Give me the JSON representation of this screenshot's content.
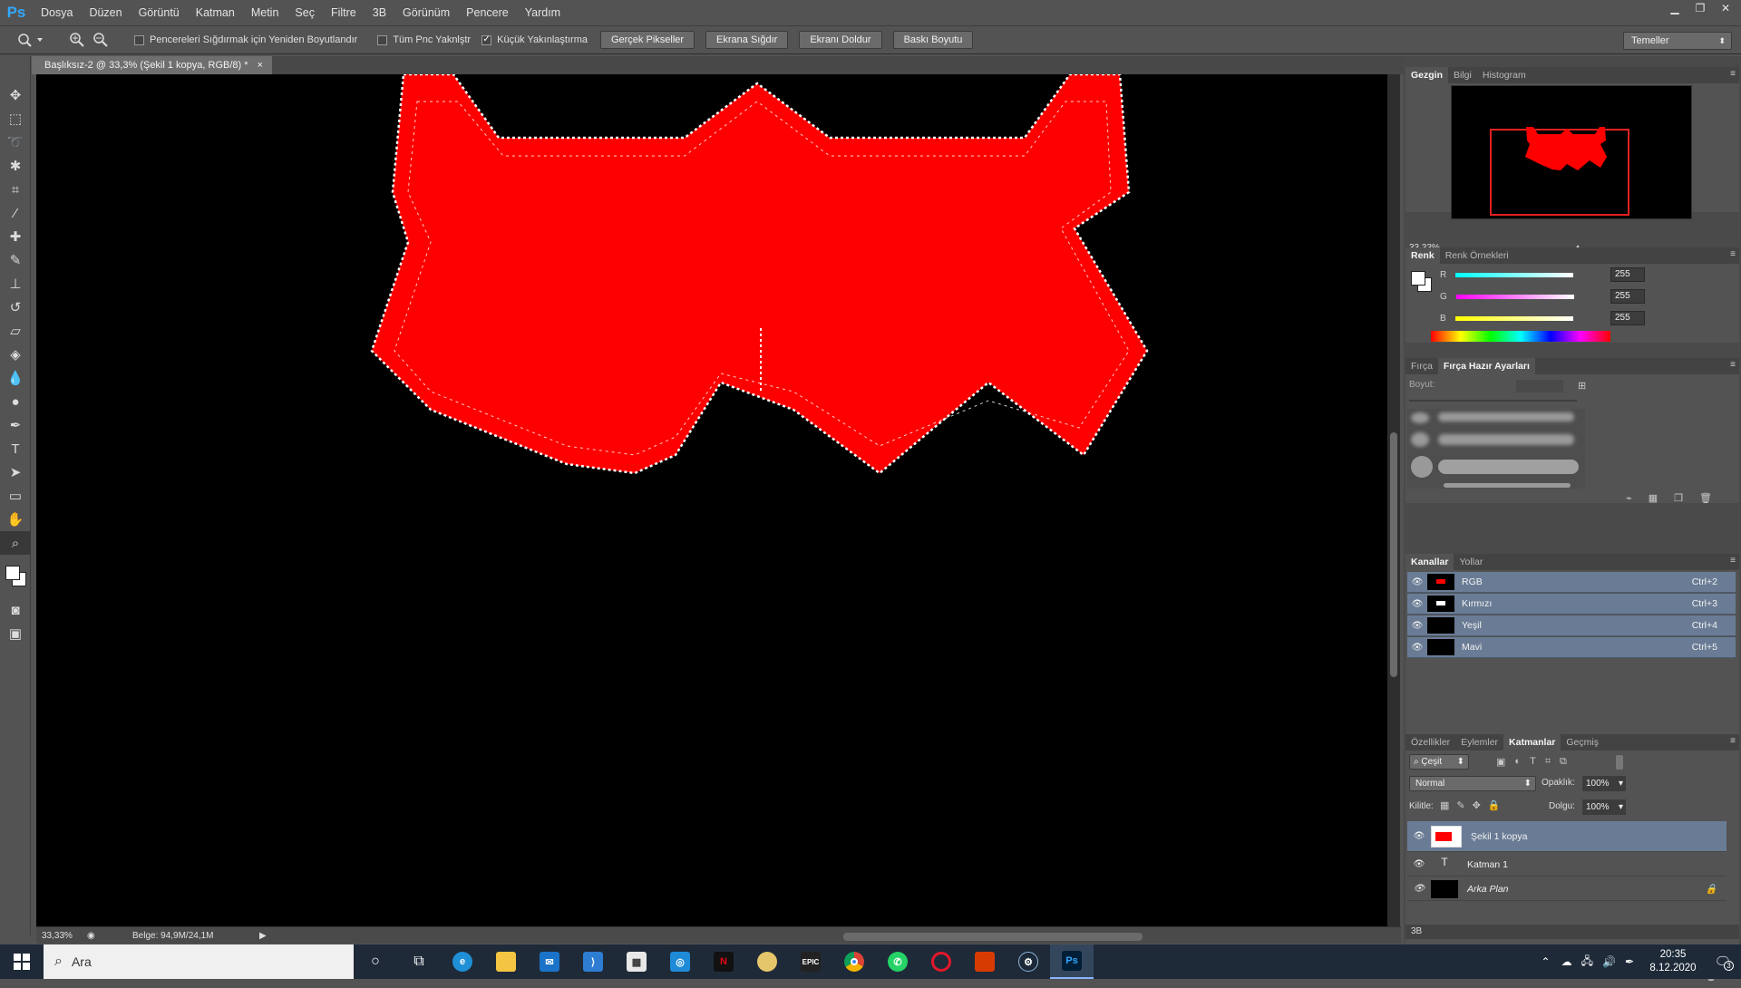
{
  "app": {
    "logo": "Ps"
  },
  "menu": [
    "Dosya",
    "Düzen",
    "Görüntü",
    "Katman",
    "Metin",
    "Seç",
    "Filtre",
    "3B",
    "Görünüm",
    "Pencere",
    "Yardım"
  ],
  "options": {
    "checkboxes": [
      {
        "label": "Pencereleri Sığdırmak için Yeniden Boyutlandır",
        "checked": false
      },
      {
        "label": "Tüm Pnc Yaknlştr",
        "checked": false
      },
      {
        "label": "Küçük Yakınlaştırma",
        "checked": true
      }
    ],
    "buttons": [
      "Gerçek Pikseller",
      "Ekrana Sığdır",
      "Ekranı Doldur",
      "Baskı Boyutu"
    ],
    "workspace": "Temeller"
  },
  "document": {
    "tab_title": "Başlıksız-2 @ 33,3% (Şekil 1 kopya, RGB/8) *",
    "close": "×",
    "fill_color": "#ff0000",
    "background_color": "#000000"
  },
  "status": {
    "zoom": "33,33%",
    "doc_info": "Belge: 94,9M/24,1M"
  },
  "navigator": {
    "tabs": [
      "Gezgin",
      "Bilgi",
      "Histogram"
    ],
    "zoom": "33,33%"
  },
  "color": {
    "tabs": [
      "Renk",
      "Renk Örnekleri"
    ],
    "channels": [
      {
        "label": "R",
        "value": "255"
      },
      {
        "label": "G",
        "value": "255"
      },
      {
        "label": "B",
        "value": "255"
      }
    ]
  },
  "brush": {
    "tabs": [
      "Fırça",
      "Fırça Hazır Ayarları"
    ],
    "size_label": "Boyut:"
  },
  "channels": {
    "tabs": [
      "Kanallar",
      "Yollar"
    ],
    "rows": [
      {
        "name": "RGB",
        "key": "Ctrl+2"
      },
      {
        "name": "Kırmızı",
        "key": "Ctrl+3"
      },
      {
        "name": "Yeşil",
        "key": "Ctrl+4"
      },
      {
        "name": "Mavi",
        "key": "Ctrl+5"
      }
    ]
  },
  "layers": {
    "tabs": [
      "Özellikler",
      "Eylemler",
      "Katmanlar",
      "Geçmiş"
    ],
    "filter": "Çeşit",
    "blend_mode": "Normal",
    "opacity_label": "Opaklık:",
    "opacity": "100%",
    "lock_label": "Kilitle:",
    "fill_label": "Dolgu:",
    "fill": "100%",
    "rows": [
      {
        "name": "Şekil 1 kopya",
        "selected": true
      },
      {
        "name": "Katman 1",
        "selected": false
      },
      {
        "name": "Arka Plan",
        "selected": false
      }
    ]
  },
  "bottom_tab": "3B",
  "taskbar": {
    "search_placeholder": "Ara",
    "time": "20:35",
    "date": "8.12.2020",
    "notification_count": "3"
  }
}
